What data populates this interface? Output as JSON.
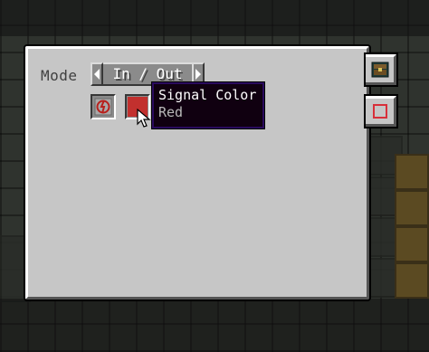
{
  "mode": {
    "label": "Mode",
    "value": "In / Out"
  },
  "buttons": {
    "redstone_icon": "redstone-signal-icon",
    "signal_color_hex": "#c2302e"
  },
  "tooltip": {
    "title": "Signal Color",
    "value": "Red"
  },
  "side_tabs": [
    {
      "icon": "chest-icon"
    },
    {
      "icon": "color-square-icon",
      "color": "#d8303a"
    }
  ],
  "colors": {
    "panel": "#c6c6c6",
    "tooltip_bg": "#100010",
    "tooltip_border": "#2a0a5e"
  }
}
